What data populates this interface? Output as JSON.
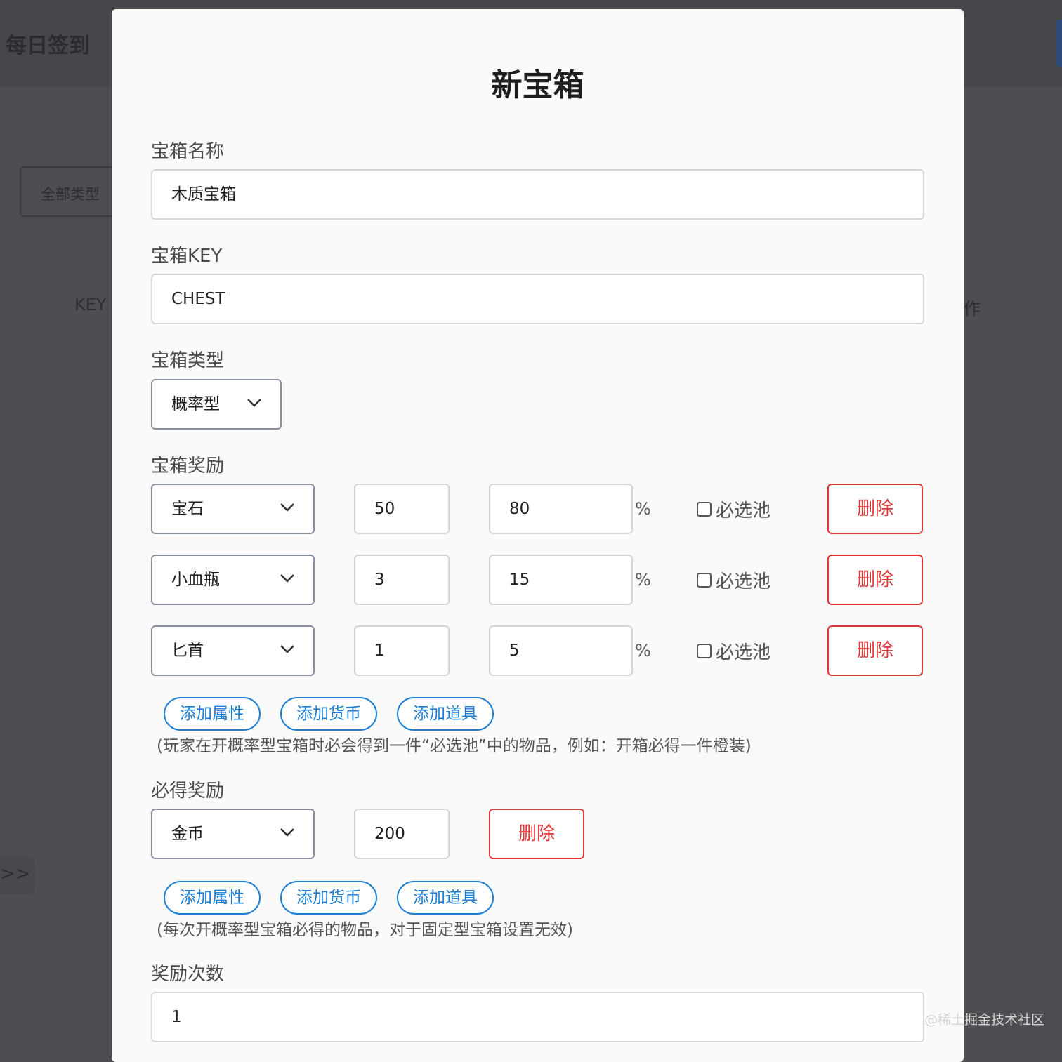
{
  "background": {
    "title": "每日签到",
    "filter_label": "全部类型",
    "column_key": "KEY",
    "column_op": "作",
    "expand_label": ">>"
  },
  "modal": {
    "title": "新宝箱",
    "name_label": "宝箱名称",
    "name_value": "木质宝箱",
    "key_label": "宝箱KEY",
    "key_value": "CHEST",
    "type_label": "宝箱类型",
    "type_value": "概率型",
    "rewards_label": "宝箱奖励",
    "rewards": [
      {
        "item": "宝石",
        "count": "50",
        "prob": "80",
        "pct": "%",
        "required_label": "必选池",
        "delete": "删除"
      },
      {
        "item": "小血瓶",
        "count": "3",
        "prob": "15",
        "pct": "%",
        "required_label": "必选池",
        "delete": "删除"
      },
      {
        "item": "匕首",
        "count": "1",
        "prob": "5",
        "pct": "%",
        "required_label": "必选池",
        "delete": "删除"
      }
    ],
    "add_buttons": [
      "添加属性",
      "添加货币",
      "添加道具"
    ],
    "rewards_hint": "(玩家在开概率型宝箱时必会得到一件“必选池”中的物品，例如：开箱必得一件橙装)",
    "guaranteed_label": "必得奖励",
    "guaranteed": {
      "item": "金币",
      "count": "200",
      "delete": "删除"
    },
    "guaranteed_hint": "(每次开概率型宝箱必得的物品，对于固定型宝箱设置无效)",
    "times_label": "奖励次数",
    "times_value": "1"
  },
  "watermark": "@稀土掘金技术社区"
}
